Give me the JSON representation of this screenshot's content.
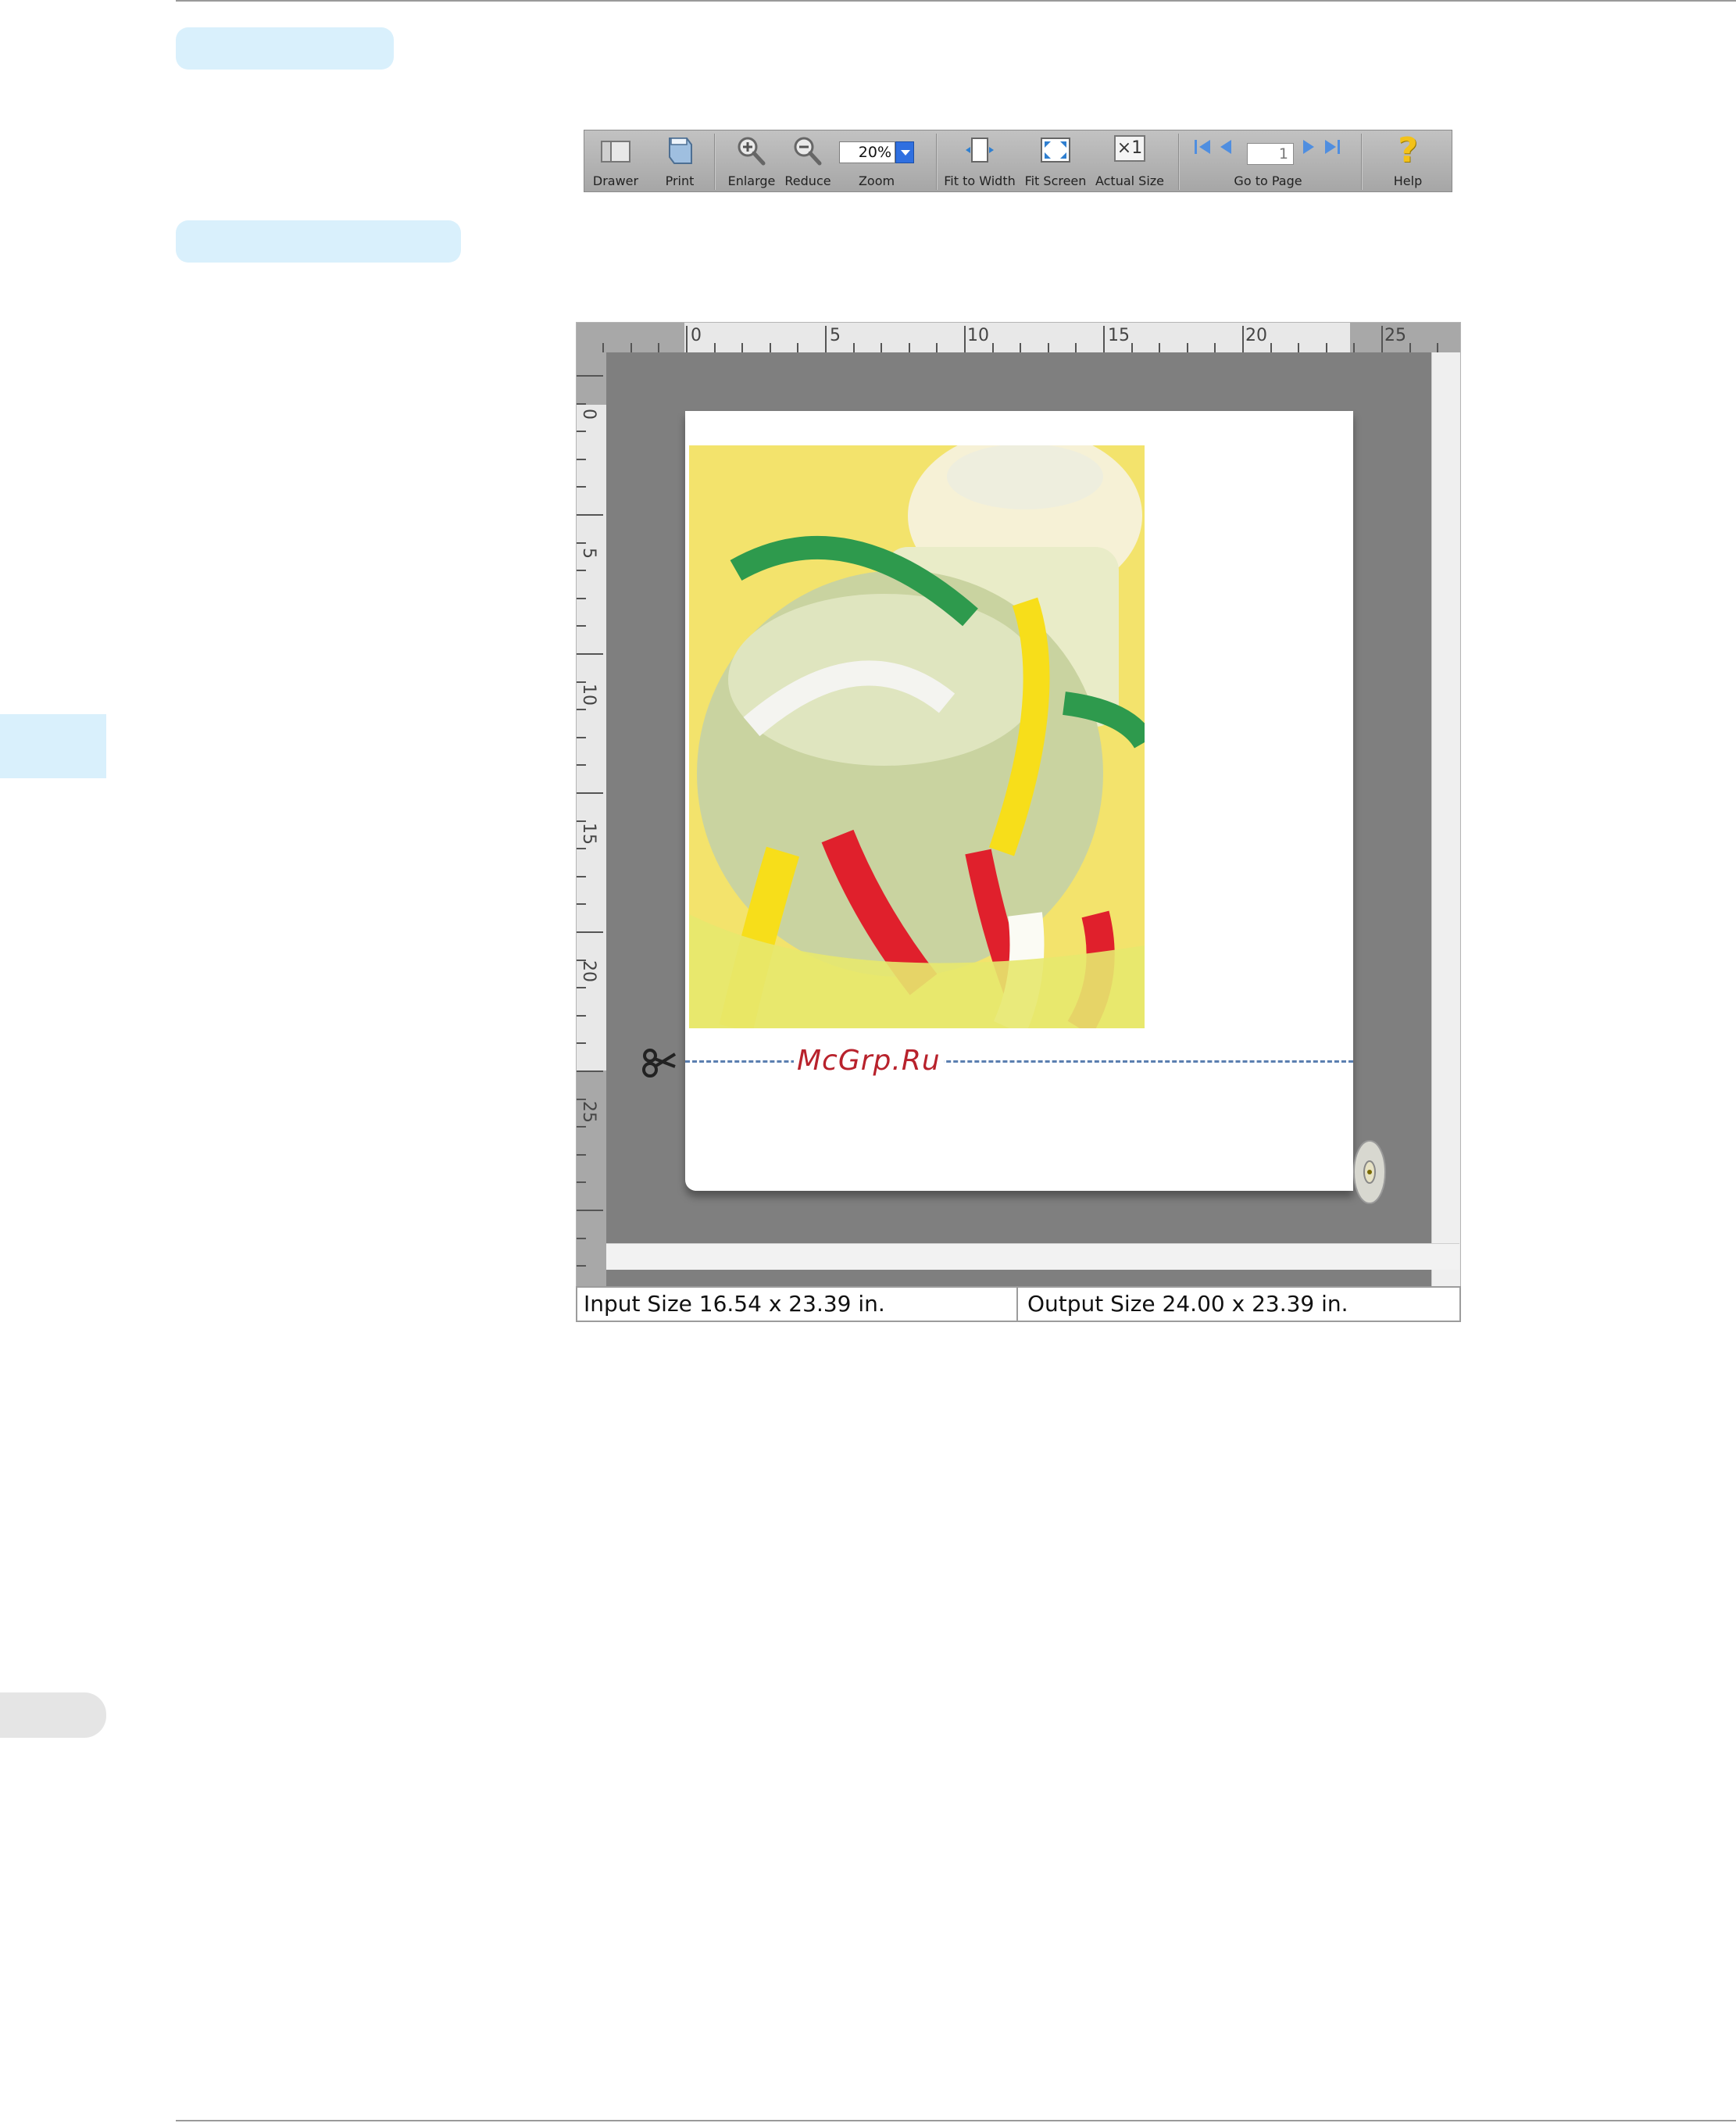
{
  "toolbar": {
    "drawer": "Drawer",
    "print": "Print",
    "enlarge": "Enlarge",
    "reduce": "Reduce",
    "zoom_label": "Zoom",
    "zoom_value": "20%",
    "fit_width": "Fit to Width",
    "fit_screen": "Fit Screen",
    "actual_size": "Actual Size",
    "actual_size_glyph": "×1",
    "go_to_page": "Go to Page",
    "page_value": "1",
    "help": "Help",
    "help_glyph": "?"
  },
  "ruler": {
    "h_labels": [
      "0",
      "5",
      "10",
      "15",
      "20",
      "25"
    ],
    "v_labels": [
      "0",
      "5",
      "10",
      "15",
      "20",
      "25"
    ]
  },
  "preview": {
    "cut_label": "McGrp.Ru"
  },
  "status": {
    "input_size": "Input Size 16.54 x 23.39 in.",
    "output_size": "Output Size 24.00 x 23.39 in."
  },
  "colors": {
    "accent_pill": "#d9f0fc",
    "cut_line": "#5b7fb0",
    "zoom_dropdown": "#2f6fe0",
    "help_icon": "#f3c21a"
  }
}
